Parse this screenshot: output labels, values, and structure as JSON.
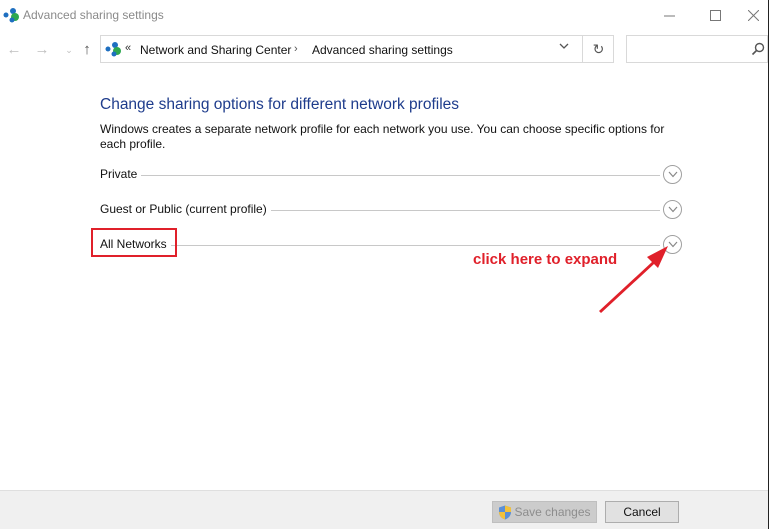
{
  "window": {
    "title": "Advanced sharing settings",
    "controls": {
      "minimize": "minimize",
      "maximize": "maximize",
      "close": "close"
    }
  },
  "nav": {
    "back_icon": "←",
    "forward_icon": "→",
    "recent_icon": "⌄",
    "up_icon": "↑"
  },
  "address": {
    "overflow": "«",
    "breadcrumbs": [
      "Network and Sharing Center",
      "Advanced sharing settings"
    ],
    "separator": "›",
    "dropdown_icon": "⌄",
    "refresh_icon": "↻"
  },
  "search": {
    "value": "",
    "placeholder": ""
  },
  "main": {
    "heading": "Change sharing options for different network profiles",
    "description": "Windows creates a separate network profile for each network you use. You can choose specific options for each profile.",
    "profiles": [
      {
        "label": "Private",
        "expanded": false
      },
      {
        "label": "Guest or Public (current profile)",
        "expanded": false
      },
      {
        "label": "All Networks",
        "expanded": false
      }
    ]
  },
  "annotation": {
    "text": "click here to expand",
    "color": "#e0202a"
  },
  "footer": {
    "save_label": "Save changes",
    "save_enabled": false,
    "cancel_label": "Cancel"
  },
  "colors": {
    "heading": "#1e3c8c",
    "annotation": "#e0202a"
  }
}
